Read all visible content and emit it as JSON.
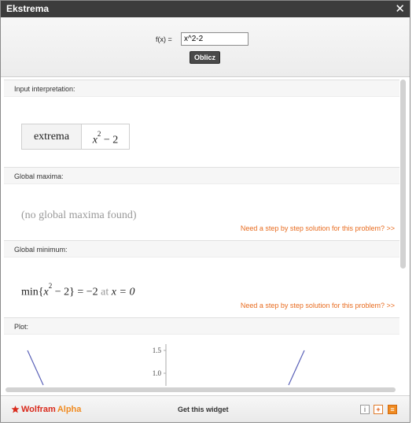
{
  "window": {
    "title": "Ekstrema",
    "close_glyph": "✕"
  },
  "input": {
    "label": "f(x) =",
    "value": "x^2-2",
    "submit_label": "Oblicz"
  },
  "pods": [
    {
      "title": "Input interpretation:",
      "left": "extrema",
      "right_base": "x",
      "right_exp": "2",
      "right_tail": " − 2"
    },
    {
      "title": "Global maxima:",
      "result": "(no global maxima found)"
    },
    {
      "title": "Global minimum:",
      "result": {
        "prefix": "min",
        "open": "{",
        "base": "x",
        "exp": "2",
        "tail": " − 2",
        "close": "}",
        "eq": " = −2 ",
        "at": "at",
        "cond": " x = 0"
      }
    },
    {
      "title": "Plot:",
      "y_ticks": [
        "1.5",
        "1.0"
      ]
    }
  ],
  "step_link": "Need a step by step solution for this problem?  >>",
  "footer": {
    "logo_w": "Wolfram",
    "logo_a": "Alpha",
    "get_widget": "Get this widget",
    "info_glyph": "i",
    "add_glyph": "+",
    "menu_glyph": "≡"
  },
  "colors": {
    "titlebar": "#3c3c3c",
    "link": "#e86c20",
    "brand_red": "#d92a1c",
    "brand_orange": "#f08b21"
  }
}
